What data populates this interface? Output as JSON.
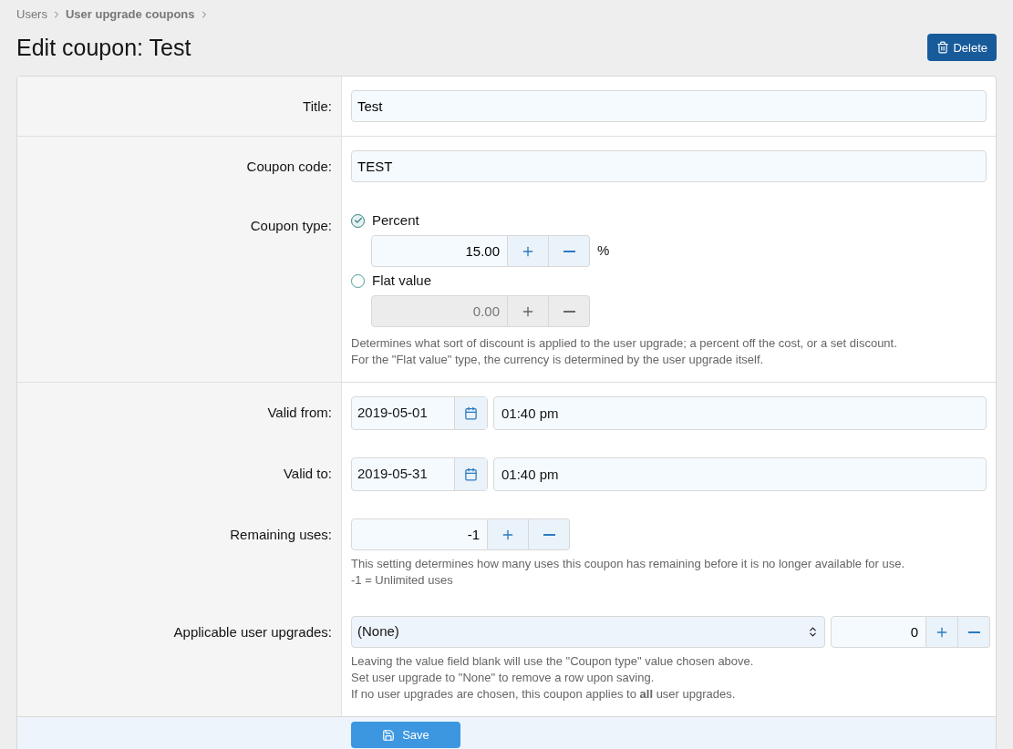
{
  "breadcrumbs": [
    {
      "label": "Users",
      "bold": false
    },
    {
      "label": "User upgrade coupons",
      "bold": true
    }
  ],
  "page_title": "Edit coupon: Test",
  "delete_button": "Delete",
  "sections": [
    {
      "rows": [
        {
          "kind": "text",
          "label": "Title:",
          "value": "Test"
        }
      ]
    },
    {
      "rows": [
        {
          "kind": "text",
          "label": "Coupon code:",
          "value": "TEST"
        },
        {
          "kind": "radio_group",
          "label": "Coupon type:",
          "options": [
            {
              "label": "Percent",
              "selected": true,
              "number": {
                "value": "15.00",
                "disabled": false
              },
              "suffix": "%"
            },
            {
              "label": "Flat value",
              "selected": false,
              "number": {
                "value": "0.00",
                "disabled": true
              }
            }
          ],
          "hints": [
            "Determines what sort of discount is applied to the user upgrade; a percent off the cost, or a set discount.",
            "For the \"Flat value\" type, the currency is determined by the user upgrade itself."
          ]
        }
      ]
    },
    {
      "rows": [
        {
          "kind": "datetime",
          "label": "Valid from:",
          "date": "2019-05-01",
          "time": "01:40 pm"
        },
        {
          "kind": "datetime",
          "label": "Valid to:",
          "date": "2019-05-31",
          "time": "01:40 pm"
        },
        {
          "kind": "number",
          "label": "Remaining uses:",
          "number": {
            "value": "-1",
            "disabled": false
          },
          "hints": [
            "This setting determines how many uses this coupon has remaining before it is no longer available for use.",
            "-1 = Unlimited uses"
          ]
        },
        {
          "kind": "upgrades",
          "label": "Applicable user upgrades:",
          "select": "(None)",
          "number": {
            "value": "0",
            "disabled": false
          },
          "hints": [
            "Leaving the value field blank will use the \"Coupon type\" value chosen above.",
            "Set user upgrade to \"None\" to remove a row upon saving.",
            "If no user upgrades are chosen, this coupon applies to **all** user upgrades."
          ]
        }
      ]
    }
  ],
  "save_button": "Save"
}
